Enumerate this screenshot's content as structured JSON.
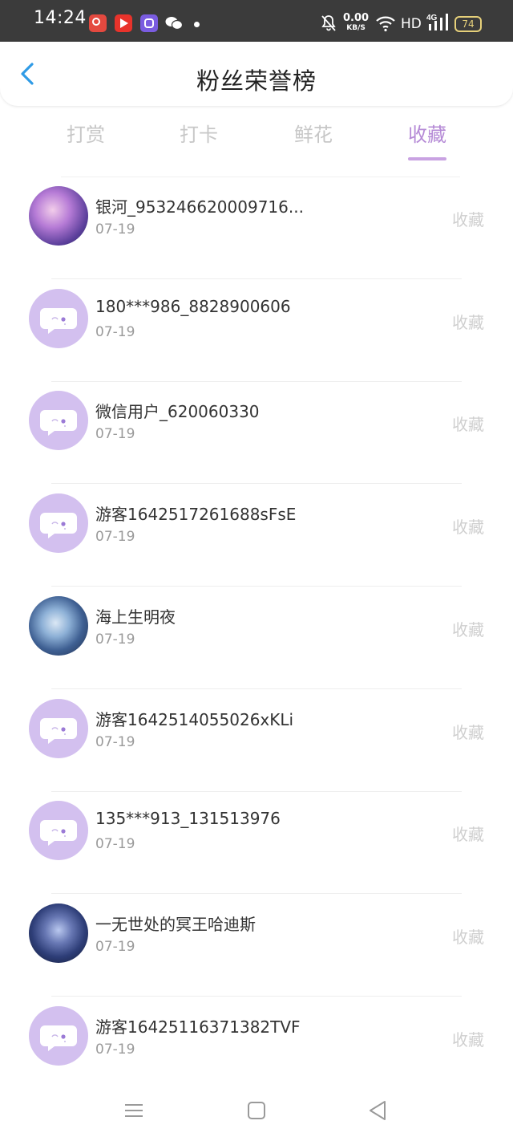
{
  "status_bar": {
    "time": "14:24",
    "net_speed_value": "0.00",
    "net_speed_unit": "KB/S",
    "hd": "HD",
    "network": "4G",
    "battery": "74"
  },
  "header": {
    "title": "粉丝荣誉榜"
  },
  "tabs": [
    {
      "label": "打赏",
      "active": false
    },
    {
      "label": "打卡",
      "active": false
    },
    {
      "label": "鲜花",
      "active": false
    },
    {
      "label": "收藏",
      "active": true
    }
  ],
  "colors": {
    "accent": "#b58ad6",
    "avatar_default": "#d3c0ef",
    "muted_text": "#cfcfcf"
  },
  "fans": [
    {
      "name": "银河_953246620009716...",
      "date": "07-19",
      "action": "收藏",
      "avatar": "image-purple-scene"
    },
    {
      "name": "180***986_8828900606",
      "date": "07-19",
      "action": "收藏",
      "avatar": "default-chat-bubble"
    },
    {
      "name": "微信用户_620060330",
      "date": "07-19",
      "action": "收藏",
      "avatar": "default-chat-bubble"
    },
    {
      "name": "游客1642517261688sFsE",
      "date": "07-19",
      "action": "收藏",
      "avatar": "default-chat-bubble"
    },
    {
      "name": "海上生明夜",
      "date": "07-19",
      "action": "收藏",
      "avatar": "image-anime-boy"
    },
    {
      "name": "游客1642514055026xKLi",
      "date": "07-19",
      "action": "收藏",
      "avatar": "default-chat-bubble"
    },
    {
      "name": "135***913_131513976",
      "date": "07-19",
      "action": "收藏",
      "avatar": "default-chat-bubble"
    },
    {
      "name": "一无世处的冥王哈迪斯",
      "date": "07-19",
      "action": "收藏",
      "avatar": "image-dark-character"
    },
    {
      "name": "游客16425116371382TVF",
      "date": "07-19",
      "action": "收藏",
      "avatar": "default-chat-bubble"
    }
  ]
}
